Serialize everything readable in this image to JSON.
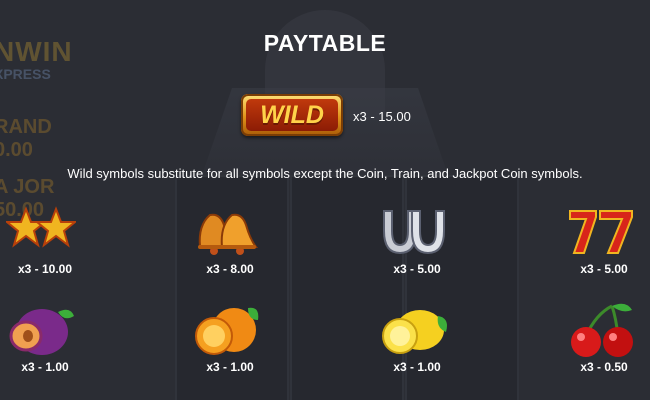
{
  "title": "PAYTABLE",
  "wild": {
    "label": "WILD",
    "payout": "x3 - 15.00",
    "description": "Wild symbols substitute for all symbols except the Coin, Train, and Jackpot Coin symbols."
  },
  "background": {
    "logo_line1": "NWIN",
    "logo_line2": "XPRESS",
    "logo_line3": "RAND",
    "logo_line4": "0.00",
    "logo_line5": "A JOR",
    "logo_line6": "50.00"
  },
  "symbols": [
    {
      "icon": "stars-icon",
      "payout": "x3 - 10.00"
    },
    {
      "icon": "bells-icon",
      "payout": "x3 - 8.00"
    },
    {
      "icon": "horseshoe-icon",
      "payout": "x3 - 5.00"
    },
    {
      "icon": "sevens-icon",
      "payout": "x3 - 5.00"
    },
    {
      "icon": "plum-icon",
      "payout": "x3 - 1.00"
    },
    {
      "icon": "orange-icon",
      "payout": "x3 - 1.00"
    },
    {
      "icon": "lemon-icon",
      "payout": "x3 - 1.00"
    },
    {
      "icon": "cherry-icon",
      "payout": "x3 - 0.50"
    }
  ],
  "colors": {
    "background": "#2b2d34",
    "text": "#ffffff",
    "wild_gold": "#ffd34a",
    "wild_red": "#c0390c"
  }
}
